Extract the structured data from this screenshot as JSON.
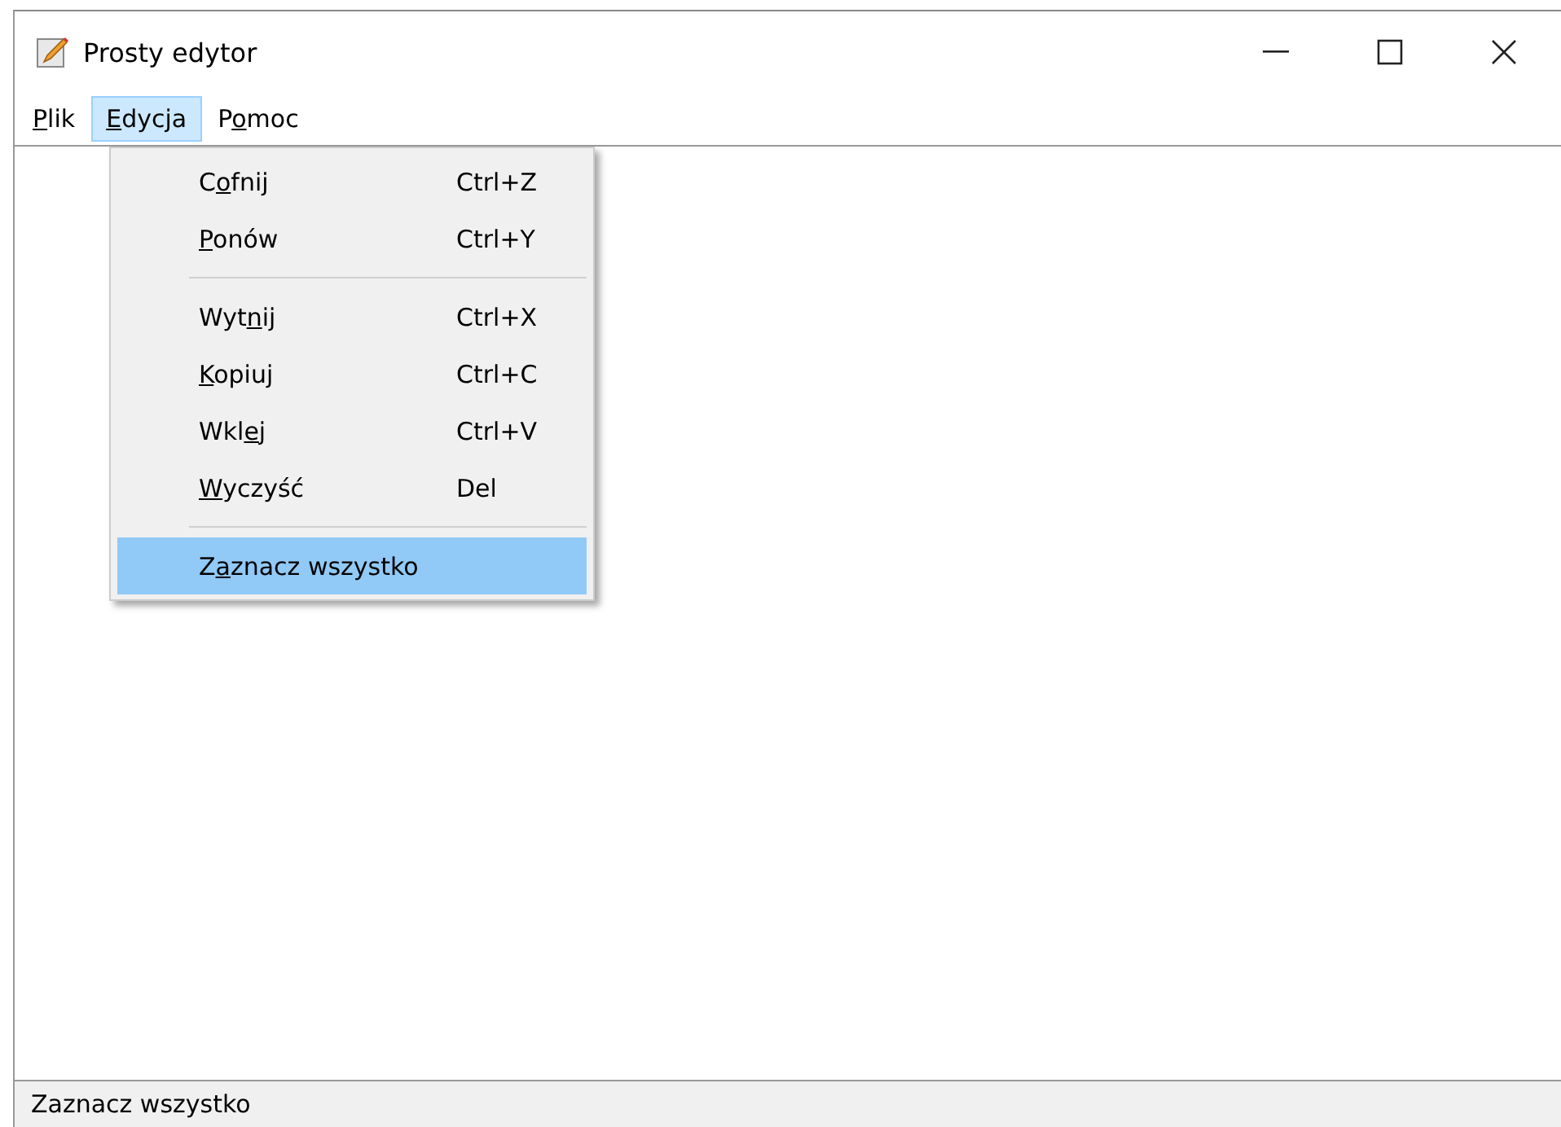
{
  "window": {
    "title": "Prosty edytor"
  },
  "menu_bar": [
    {
      "label": {
        "key": "P",
        "post": "lik"
      },
      "selected": false
    },
    {
      "label": {
        "key": "E",
        "post": "dycja"
      },
      "selected": true
    },
    {
      "label": {
        "pre": "P",
        "key": "o",
        "post": "moc"
      },
      "selected": false
    }
  ],
  "dropdown": [
    {
      "kind": "item",
      "label": {
        "pre": "C",
        "key": "o",
        "post": "fnij"
      },
      "shortcut": "Ctrl+Z",
      "selected": false
    },
    {
      "kind": "item",
      "label": {
        "key": "P",
        "post": "onów"
      },
      "shortcut": "Ctrl+Y",
      "selected": false
    },
    {
      "kind": "separator"
    },
    {
      "kind": "item",
      "label": {
        "pre": "Wyt",
        "key": "n",
        "post": "ij"
      },
      "shortcut": "Ctrl+X",
      "selected": false
    },
    {
      "kind": "item",
      "label": {
        "key": "K",
        "post": "opiuj"
      },
      "shortcut": "Ctrl+C",
      "selected": false
    },
    {
      "kind": "item",
      "label": {
        "pre": "Wkl",
        "key": "e",
        "post": "j"
      },
      "shortcut": "Ctrl+V",
      "selected": false
    },
    {
      "kind": "item",
      "label": {
        "key": "W",
        "post": "yczyść"
      },
      "shortcut": "Del",
      "selected": false
    },
    {
      "kind": "separator"
    },
    {
      "kind": "item",
      "label": {
        "pre": "Z",
        "key": "a",
        "post": "znacz wszystko"
      },
      "selected": true
    }
  ],
  "status_bar": "Zaznacz wszystko"
}
